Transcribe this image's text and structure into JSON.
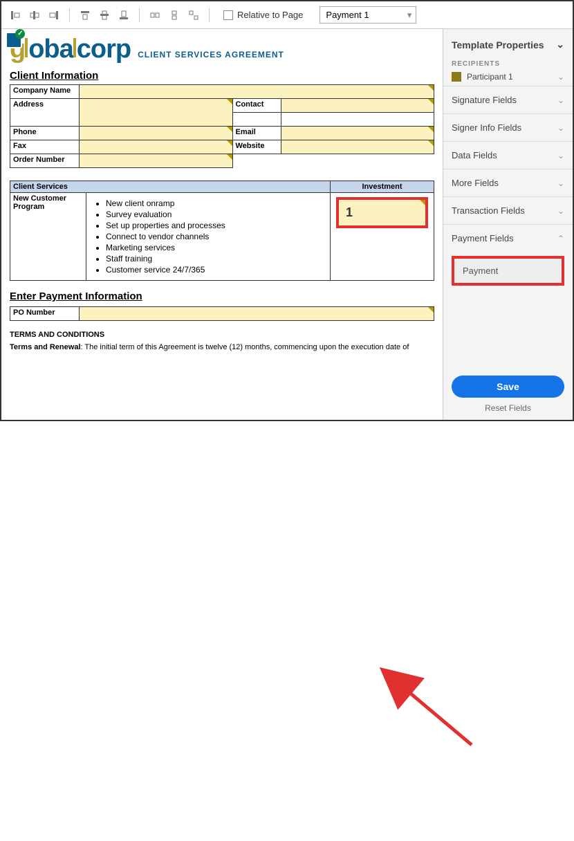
{
  "toolbar": {
    "relative_label": "Relative to Page",
    "select_value": "Payment 1"
  },
  "doc": {
    "logo_text": "globalcorp",
    "sub_title": "CLIENT SERVICES AGREEMENT",
    "section_client_info": "Client Information",
    "labels": {
      "company": "Company Name",
      "address": "Address",
      "contact": "Contact",
      "phone": "Phone",
      "email": "Email",
      "fax": "Fax",
      "website": "Website",
      "order": "Order Number"
    },
    "section_services": "Client Services",
    "section_invest": "Investment",
    "program_label": "New Customer Program",
    "services": [
      "New client onramp",
      "Survey evaluation",
      "Set up properties and processes",
      "Connect to vendor channels",
      "Marketing services",
      "Staff training",
      "Customer service 24/7/365"
    ],
    "invest_value": "1",
    "section_payment": "Enter Payment Information",
    "po_label": "PO Number",
    "terms_h": "TERMS AND CONDITIONS",
    "terms_p": "Terms and Renewal: The initial term of this Agreement is twelve (12) months, commencing upon the execution date of"
  },
  "sidebar": {
    "panel_title": "Template Properties",
    "recipients_label": "RECIPIENTS",
    "participant": "Participant 1",
    "sections": {
      "sig": "Signature Fields",
      "signer": "Signer Info Fields",
      "data": "Data Fields",
      "more": "More Fields",
      "txn": "Transaction Fields",
      "pay": "Payment Fields"
    },
    "payment_item": "Payment",
    "save": "Save",
    "reset": "Reset Fields"
  }
}
